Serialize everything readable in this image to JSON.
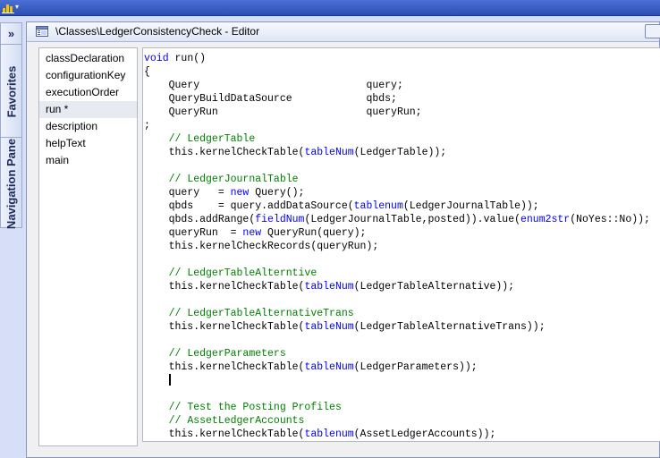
{
  "app": {
    "icon": "chart-icon",
    "menu_arrow": "▾"
  },
  "nav_pane": {
    "expand_glyph": "»",
    "favorites_label": "Favorites",
    "navigation_label": "Navigation Pane"
  },
  "editor": {
    "title": "\\Classes\\LedgerConsistencyCheck - Editor",
    "icon": "class-editor-icon",
    "close_icon": "close-icon"
  },
  "methods": [
    {
      "label": "classDeclaration",
      "selected": false
    },
    {
      "label": "configurationKey",
      "selected": false
    },
    {
      "label": "executionOrder",
      "selected": false
    },
    {
      "label": "run *",
      "selected": true
    },
    {
      "label": "description",
      "selected": false
    },
    {
      "label": "helpText",
      "selected": false
    },
    {
      "label": "main",
      "selected": false
    }
  ],
  "code": {
    "lines": [
      "void run()",
      "{",
      "    Query                           query;",
      "    QueryBuildDataSource            qbds;",
      "    QueryRun                        queryRun;",
      ";",
      "    // LedgerTable",
      "    this.kernelCheckTable(tableNum(LedgerTable));",
      "",
      "    // LedgerJournalTable",
      "    query   = new Query();",
      "    qbds    = query.addDataSource(tablenum(LedgerJournalTable));",
      "    qbds.addRange(fieldNum(LedgerJournalTable,posted)).value(enum2str(NoYes::No));",
      "    queryRun  = new QueryRun(query);",
      "    this.kernelCheckRecords(queryRun);",
      "",
      "    // LedgerTableAlterntive",
      "    this.kernelCheckTable(tableNum(LedgerTableAlternative));",
      "",
      "    // LedgerTableAlternativeTrans",
      "    this.kernelCheckTable(tableNum(LedgerTableAlternativeTrans));",
      "",
      "    // LedgerParameters",
      "    this.kernelCheckTable(tableNum(LedgerParameters));",
      "    ",
      "",
      "    // Test the Posting Profiles",
      "    // AssetLedgerAccounts",
      "    this.kernelCheckTable(tablenum(AssetLedgerAccounts));",
      "}"
    ],
    "caret_line": 24
  },
  "colors": {
    "keyword": "#0000ff",
    "comment": "#008000",
    "text": "#000000"
  }
}
